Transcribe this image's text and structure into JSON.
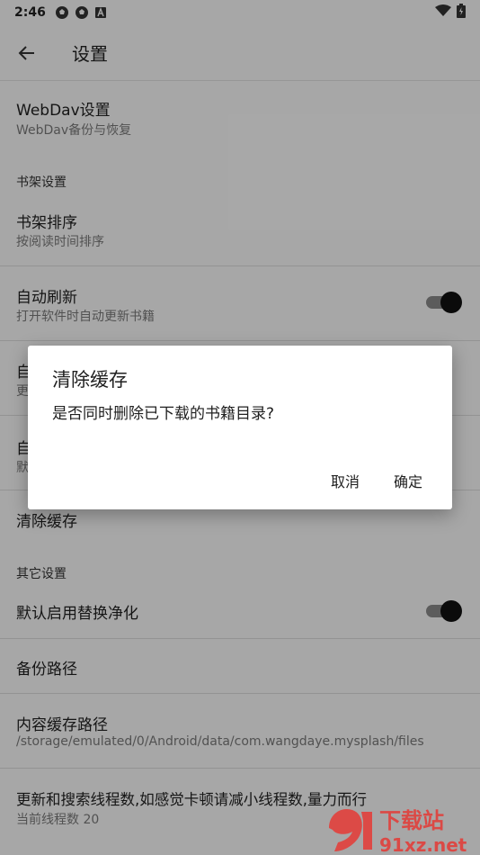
{
  "status": {
    "time": "2:46",
    "notification_icons": [
      "soccer-icon",
      "soccer-icon",
      "a-box-icon"
    ],
    "right_icons": [
      "wifi-icon",
      "battery-icon"
    ]
  },
  "appbar": {
    "title": "设置"
  },
  "settings": {
    "webdav": {
      "title": "WebDav设置",
      "subtitle": "WebDav备份与恢复"
    },
    "section_bookshelf": "书架设置",
    "sort": {
      "title": "书架排序",
      "subtitle": "按阅读时间排序"
    },
    "auto_refresh": {
      "title": "自动刷新",
      "subtitle": "打开软件时自动更新书籍",
      "enabled": true
    },
    "row4": {
      "title_partial": "自",
      "subtitle_partial": "更"
    },
    "row5": {
      "title_partial": "自",
      "subtitle_partial": "默"
    },
    "clear_cache": {
      "title": "清除缓存"
    },
    "section_other": "其它设置",
    "replace_purify": {
      "title": "默认启用替换净化",
      "enabled": true
    },
    "backup_path": {
      "title": "备份路径"
    },
    "cache_path": {
      "title": "内容缓存路径",
      "subtitle": "/storage/emulated/0/Android/data/com.wangdaye.mysplash/files"
    },
    "threads": {
      "title": "更新和搜索线程数,如感觉卡顿请减小线程数,量力而行",
      "subtitle": "当前线程数 20"
    }
  },
  "dialog": {
    "title": "清除缓存",
    "message": "是否同时删除已下载的书籍目录?",
    "cancel_label": "取消",
    "ok_label": "确定"
  },
  "watermark": {
    "brand": "下载站",
    "domain": "91xz.net"
  },
  "colors": {
    "scrim": "rgba(0,0,0,0.33)",
    "switch_thumb": "#111111",
    "watermark_red": "#e53935"
  }
}
